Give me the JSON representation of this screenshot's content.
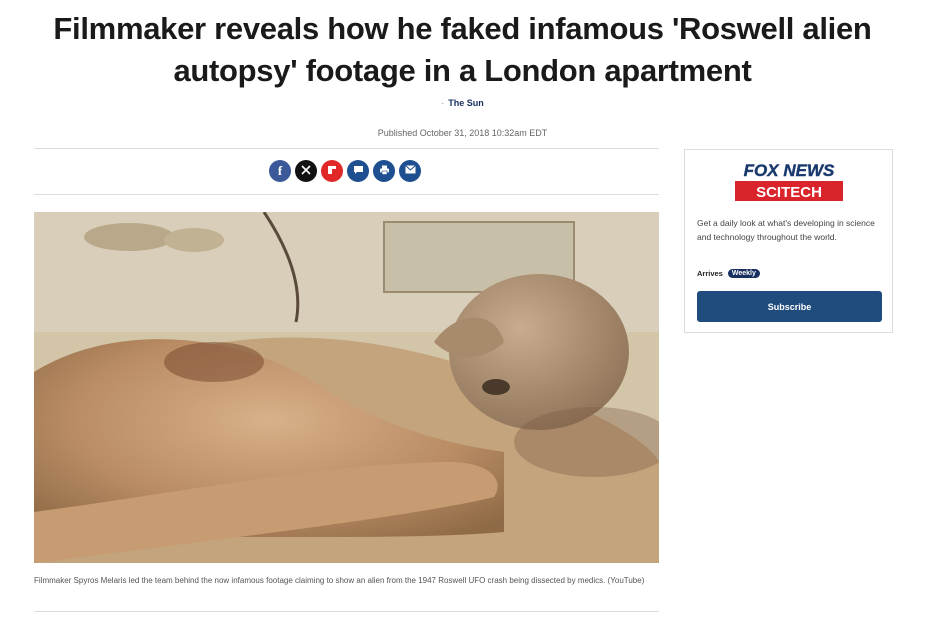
{
  "article": {
    "headline_line1": "Filmmaker reveals how he faked infamous 'Roswell alien",
    "headline_line2": "autopsy' footage in a London apartment",
    "source_label": "The Sun",
    "published": "Published October 31, 2018 10:32am EDT",
    "image_caption": "Filmmaker Spyros Melaris led the team behind the now infamous footage claiming to show an alien from the 1947 Roswell UFO crash being dissected by medics. (YouTube)"
  },
  "share_buttons": [
    {
      "name": "facebook",
      "glyph": "f"
    },
    {
      "name": "x",
      "glyph": "𝕏"
    },
    {
      "name": "flipboard",
      "glyph": "F"
    },
    {
      "name": "comments",
      "glyph": "💬"
    },
    {
      "name": "print",
      "glyph": "⎙"
    },
    {
      "name": "email",
      "glyph": "✉"
    }
  ],
  "sidebar": {
    "logo_top": "FOX NEWS",
    "logo_bottom": "SCITECH",
    "promo_text": "Get a daily look at what's developing in science and technology throughout the world.",
    "arrives_label": "Arrives",
    "frequency_badge": "Weekly",
    "subscribe_label": "Subscribe"
  },
  "colors": {
    "accent_navy": "#183060",
    "subscribe_blue": "#1f4b7d",
    "fox_red": "#d8242a"
  }
}
